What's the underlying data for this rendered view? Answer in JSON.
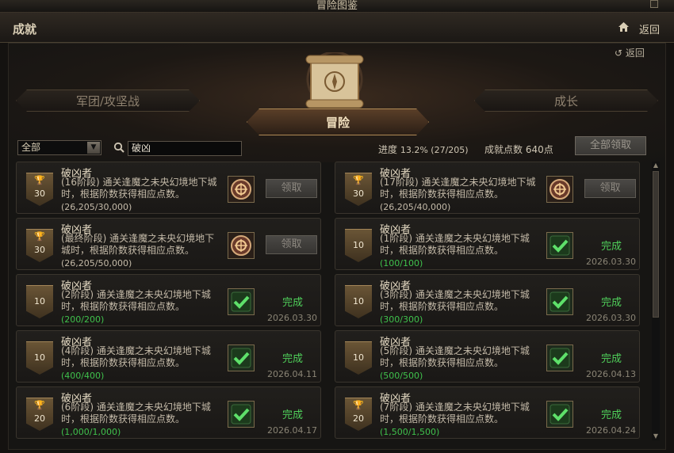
{
  "window": {
    "title": "冒险图鉴"
  },
  "header": {
    "title": "成就",
    "back_label": "返回",
    "home_icon": "home-icon"
  },
  "panel": {
    "back_label": "返回"
  },
  "tabs": {
    "left": "军团/攻坚战",
    "center": "冒险",
    "right": "成长"
  },
  "filter": {
    "category_selected": "全部",
    "search_value": "破凶",
    "progress_label": "进度",
    "progress_value": "13.2% (27/205)",
    "points_label": "成就点数",
    "points_value": "640点",
    "claim_all_label": "全部领取"
  },
  "colors": {
    "complete": "#4fcf5a",
    "accent": "#b08a55"
  },
  "achievements": [
    {
      "title": "破凶者",
      "desc": "(16阶段) 通关逢魔之未央幻境地下城时，根据阶数获得相应点数。",
      "progress": "(26,205/30,000)",
      "points": "30",
      "trophy": true,
      "state": "claim",
      "action": "领取",
      "date": ""
    },
    {
      "title": "破凶者",
      "desc": "(17阶段) 通关逢魔之未央幻境地下城时，根据阶数获得相应点数。",
      "progress": "(26,205/40,000)",
      "points": "30",
      "trophy": true,
      "state": "claim",
      "action": "领取",
      "date": ""
    },
    {
      "title": "破凶者",
      "desc": "(最终阶段) 通关逢魔之未央幻境地下城时，根据阶数获得相应点数。",
      "progress": "(26,205/50,000)",
      "points": "30",
      "trophy": true,
      "state": "claim",
      "action": "领取",
      "date": ""
    },
    {
      "title": "破凶者",
      "desc": "(1阶段) 通关逢魔之未央幻境地下城时，根据阶数获得相应点数。",
      "progress": "(100/100)",
      "points": "10",
      "trophy": false,
      "state": "done",
      "action": "完成",
      "date": "2026.03.30"
    },
    {
      "title": "破凶者",
      "desc": "(2阶段) 通关逢魔之未央幻境地下城时，根据阶数获得相应点数。",
      "progress": "(200/200)",
      "points": "10",
      "trophy": false,
      "state": "done",
      "action": "完成",
      "date": "2026.03.30"
    },
    {
      "title": "破凶者",
      "desc": "(3阶段) 通关逢魔之未央幻境地下城时，根据阶数获得相应点数。",
      "progress": "(300/300)",
      "points": "10",
      "trophy": false,
      "state": "done",
      "action": "完成",
      "date": "2026.03.30"
    },
    {
      "title": "破凶者",
      "desc": "(4阶段) 通关逢魔之未央幻境地下城时，根据阶数获得相应点数。",
      "progress": "(400/400)",
      "points": "10",
      "trophy": false,
      "state": "done",
      "action": "完成",
      "date": "2026.04.11"
    },
    {
      "title": "破凶者",
      "desc": "(5阶段) 通关逢魔之未央幻境地下城时，根据阶数获得相应点数。",
      "progress": "(500/500)",
      "points": "10",
      "trophy": false,
      "state": "done",
      "action": "完成",
      "date": "2026.04.13"
    },
    {
      "title": "破凶者",
      "desc": "(6阶段) 通关逢魔之未央幻境地下城时，根据阶数获得相应点数。",
      "progress": "(1,000/1,000)",
      "points": "20",
      "trophy": true,
      "state": "done",
      "action": "完成",
      "date": "2026.04.17"
    },
    {
      "title": "破凶者",
      "desc": "(7阶段) 通关逢魔之未央幻境地下城时，根据阶数获得相应点数。",
      "progress": "(1,500/1,500)",
      "points": "20",
      "trophy": true,
      "state": "done",
      "action": "完成",
      "date": "2026.04.24"
    }
  ]
}
